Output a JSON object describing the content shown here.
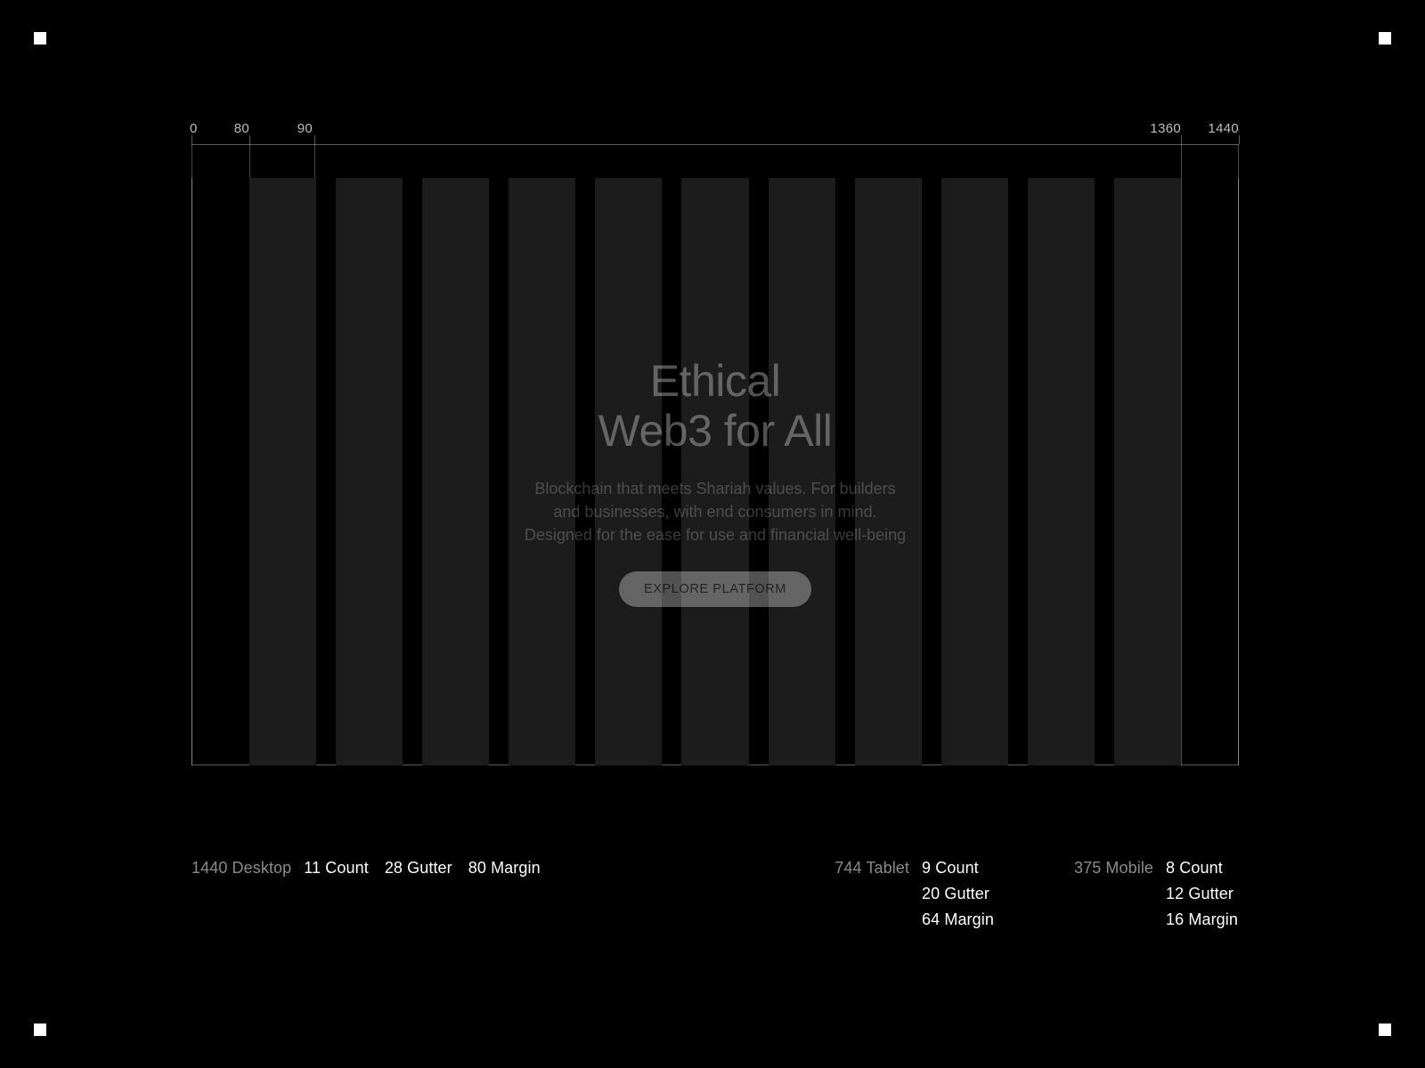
{
  "ruler": {
    "labels": {
      "l0": "0",
      "l80": "80",
      "l90": "90",
      "l1360": "1360",
      "l1440": "1440"
    }
  },
  "hero": {
    "title_line1": "Ethical",
    "title_line2": "Web3 for All",
    "subtitle": "Blockchain that meets Shariah values. For builders and businesses, with end consumers in mind. Designed for the ease for use and financial well-being",
    "cta_label": "EXPLORE PLATFORM"
  },
  "grid_specs": {
    "desktop": {
      "device": "1440 Desktop",
      "count": "11 Count",
      "gutter": "28 Gutter",
      "margin": "80 Margin"
    },
    "tablet": {
      "device": "744 Tablet",
      "count": "9 Count",
      "gutter": "20 Gutter",
      "margin": "64 Margin"
    },
    "mobile": {
      "device": "375 Mobile",
      "count": "8 Count",
      "gutter": "12 Gutter",
      "margin": "16 Margin"
    }
  }
}
